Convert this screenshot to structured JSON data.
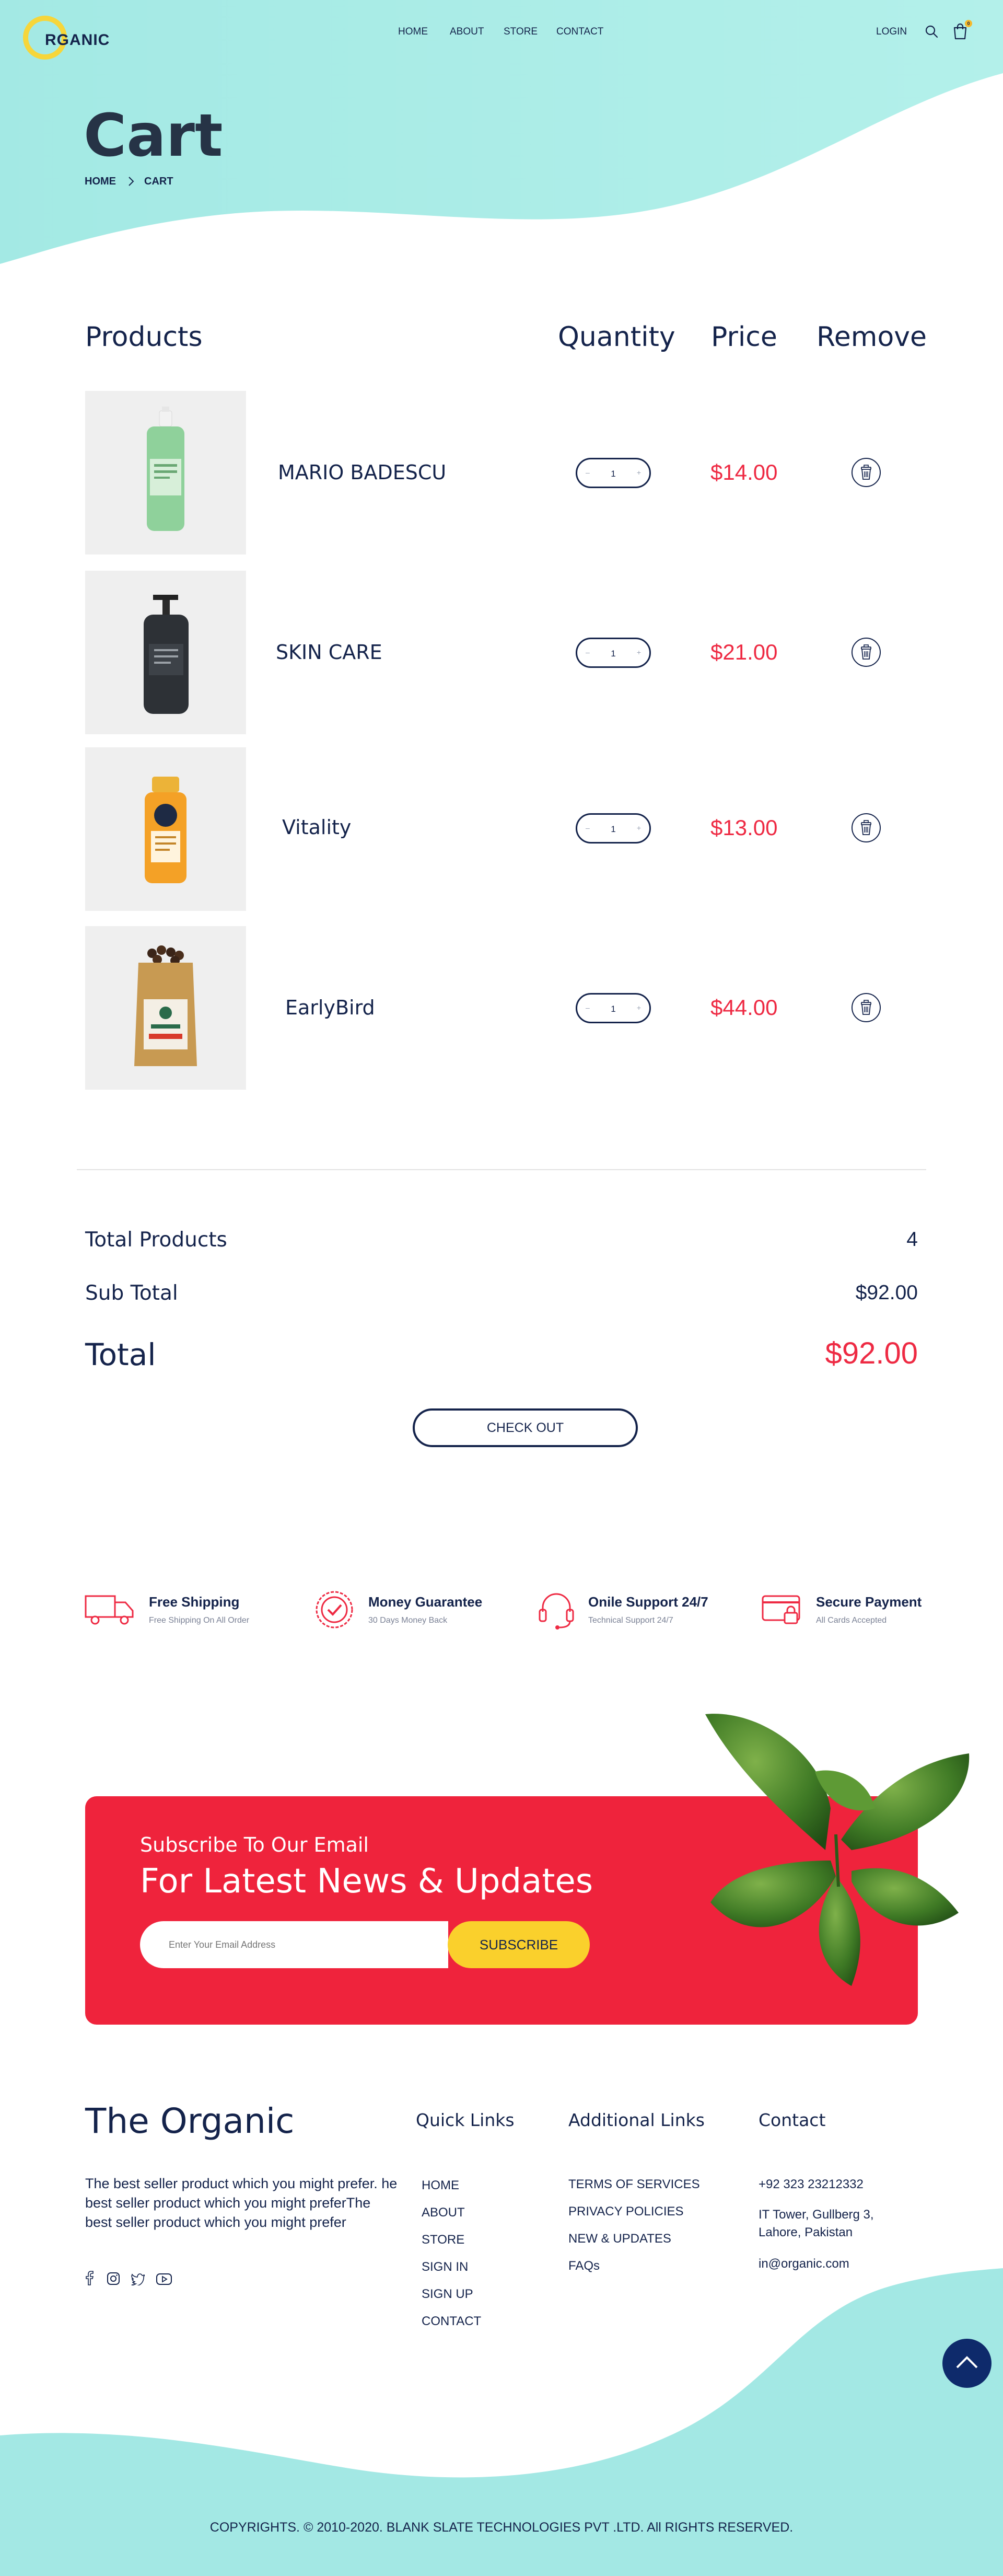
{
  "brand": {
    "logo_text": "RGANIC",
    "footer_name": "The Organic"
  },
  "nav": {
    "items": [
      "HOME",
      "ABOUT",
      "STORE",
      "CONTACT"
    ],
    "login": "LOGIN",
    "cart_count": "0"
  },
  "hero": {
    "title": "Cart",
    "breadcrumb": [
      "HOME",
      "CART"
    ]
  },
  "cart": {
    "headers": {
      "products": "Products",
      "quantity": "Quantity",
      "price": "Price",
      "remove": "Remove"
    },
    "items": [
      {
        "name": "MARIO BADESCU",
        "qty": "1",
        "price": "$14.00"
      },
      {
        "name": "SKIN CARE",
        "qty": "1",
        "price": "$21.00"
      },
      {
        "name": "Vitality",
        "qty": "1",
        "price": "$13.00"
      },
      {
        "name": "EarlyBird",
        "qty": "1",
        "price": "$44.00"
      }
    ]
  },
  "summary": {
    "total_products_label": "Total Products",
    "total_products": "4",
    "subtotal_label": "Sub Total",
    "subtotal": "$92.00",
    "total_label": "Total",
    "total": "$92.00",
    "checkout": "CHECK OUT"
  },
  "features": [
    {
      "icon": "truck-icon",
      "title": "Free Shipping",
      "sub": "Free Shipping On All Order"
    },
    {
      "icon": "badge-check-icon",
      "title": "Money Guarantee",
      "sub": "30 Days Money Back"
    },
    {
      "icon": "headset-icon",
      "title": "Onile Support 24/7",
      "sub": "Technical Support 24/7"
    },
    {
      "icon": "credit-card-lock-icon",
      "title": "Secure Payment",
      "sub": "All Cards Accepted"
    }
  ],
  "subscribe": {
    "kicker": "Subscribe To Our Email",
    "heading": "For Latest News & Updates",
    "placeholder": "Enter Your Email Address",
    "button": "SUBSCRIBE"
  },
  "footer": {
    "about": "The best seller product which you might prefer. he best seller product which you might preferThe best seller product which you might prefer",
    "quick_title": "Quick Links",
    "quick_links": [
      "HOME",
      "ABOUT",
      "STORE",
      "SIGN IN",
      "SIGN UP",
      "CONTACT"
    ],
    "additional_title": "Additional Links",
    "additional_links": [
      "TERMS OF SERVICES",
      "PRIVACY POLICIES",
      "NEW & UPDATES",
      "FAQs"
    ],
    "contact_title": "Contact",
    "phone": "+92 323 23212332",
    "address_1": "IT Tower, Gullberg 3,",
    "address_2": "Lahore, Pakistan",
    "email": "in@organic.com",
    "copyright": "COPYRIGHTS. © 2010-2020. BLANK SLATE TECHNOLOGIES PVT .LTD. All RIGHTS RESERVED."
  },
  "colors": {
    "navy": "#14234b",
    "accent_red": "#ee2a43",
    "teal": "#a6ebe6",
    "yellow": "#fad02c"
  }
}
